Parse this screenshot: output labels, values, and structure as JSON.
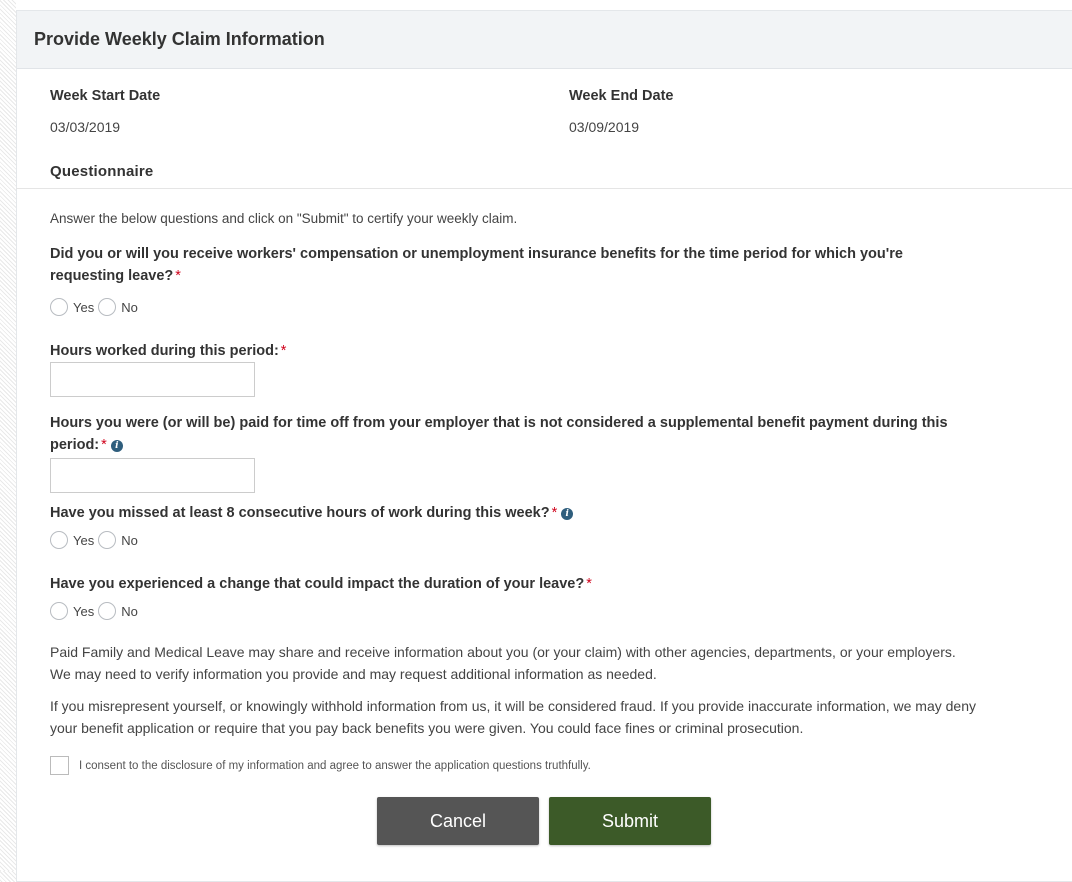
{
  "colors": {
    "header_bg": "#f2f4f6",
    "required": "#d0021b",
    "info_icon": "#2f5e7d",
    "cancel_button": "#555555",
    "submit_button": "#3c5a28"
  },
  "header": {
    "title": "Provide Weekly Claim Information"
  },
  "week": {
    "start_label": "Week Start Date",
    "start_value": "03/03/2019",
    "end_label": "Week End Date",
    "end_value": "03/09/2019"
  },
  "questionnaire": {
    "title": "Questionnaire",
    "intro": "Answer the below questions and click on \"Submit\" to certify your weekly claim.",
    "required_mark": "*",
    "info_glyph": "i",
    "yes_label": "Yes",
    "no_label": "No",
    "q1": "Did you or will you receive workers' compensation or unemployment insurance benefits for the time period for which you're requesting leave?",
    "q2": "Hours worked during this period:",
    "q2_value": "",
    "q3": "Hours you were (or will be) paid for time off from your employer that is not considered a supplemental benefit payment during this period:",
    "q3_value": "",
    "q4": "Have you missed at least 8 consecutive hours of work during this week?",
    "q5": "Have you experienced a change that could impact the duration of your leave?"
  },
  "disclosure": {
    "para1": "Paid Family and Medical Leave may share and receive information about you (or your claim) with other agencies, departments, or your employers. We may need to verify information you provide and may request additional information as needed.",
    "para2": "If you misrepresent yourself, or knowingly withhold information from us, it will be considered fraud. If you provide inaccurate information, we may deny your benefit application or require that you pay back benefits you were given. You could face fines or criminal prosecution.",
    "consent": "I consent to the disclosure of my information and agree to answer the application questions truthfully."
  },
  "actions": {
    "cancel": "Cancel",
    "submit": "Submit"
  }
}
